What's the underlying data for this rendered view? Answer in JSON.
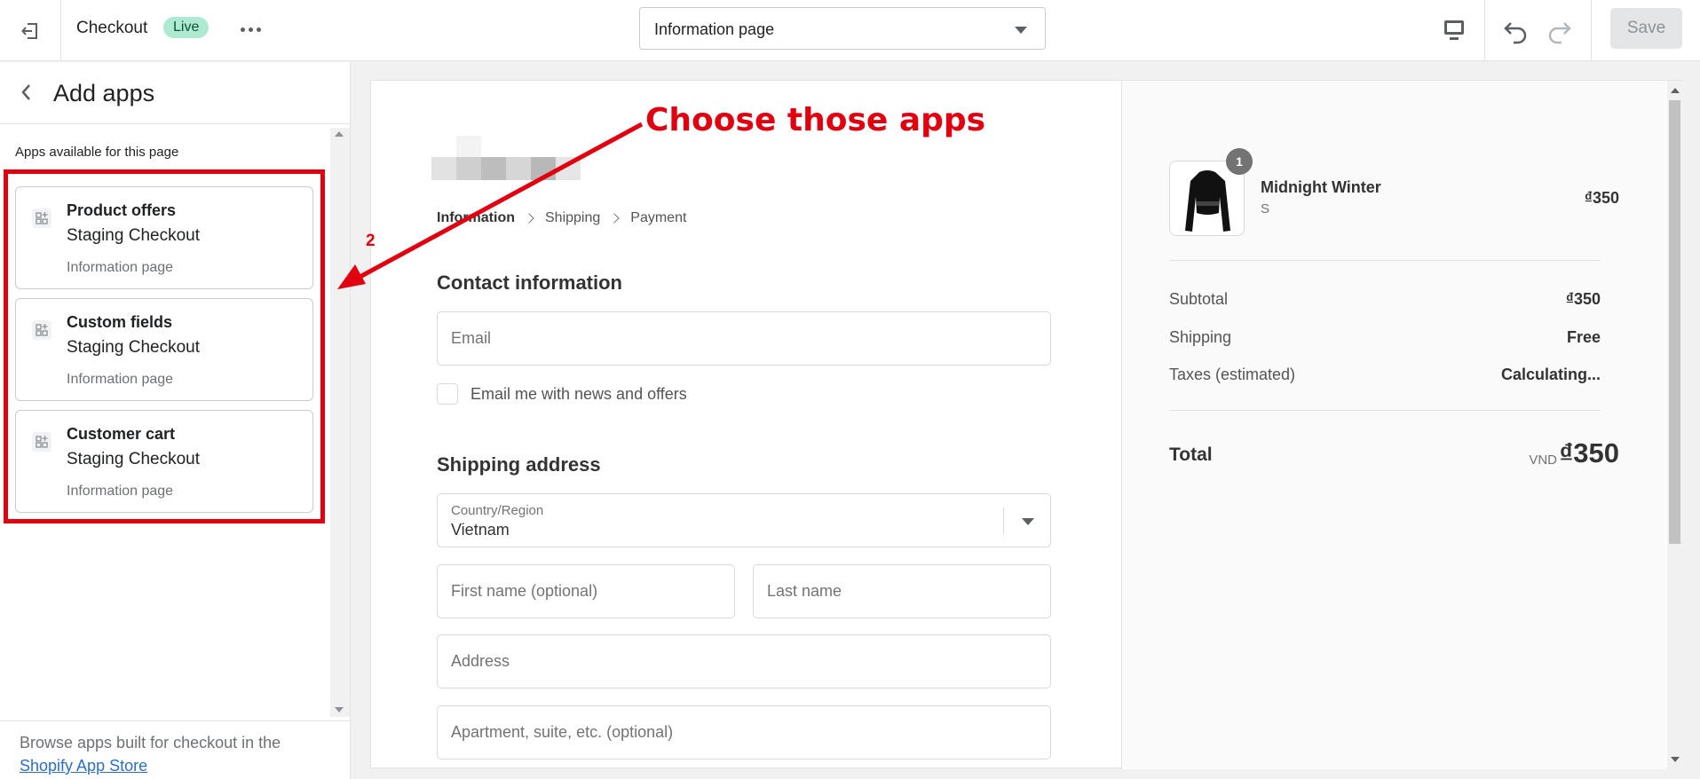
{
  "topbar": {
    "exit_icon": "exit-icon",
    "app_name": "Checkout",
    "status_badge": "Live",
    "more_icon": "more-horizontal-icon",
    "page_select_value": "Information page",
    "desktop_icon": "desktop-icon",
    "undo_icon": "undo-icon",
    "redo_icon": "redo-icon",
    "save_label": "Save"
  },
  "sidebar": {
    "back_icon": "chevron-left-icon",
    "title": "Add apps",
    "section_label": "Apps available for this page",
    "apps": [
      {
        "name": "Product offers",
        "source": "Staging Checkout",
        "page": "Information page",
        "icon": "app-block-icon"
      },
      {
        "name": "Custom fields",
        "source": "Staging Checkout",
        "page": "Information page",
        "icon": "app-block-icon"
      },
      {
        "name": "Customer cart",
        "source": "Staging Checkout",
        "page": "Information page",
        "icon": "app-block-icon"
      }
    ],
    "footer_text": "Browse apps built for checkout in the",
    "footer_link": "Shopify App Store"
  },
  "checkout": {
    "breadcrumbs": [
      "Information",
      "Shipping",
      "Payment"
    ],
    "contact_heading": "Contact information",
    "email_placeholder": "Email",
    "newsletter_label": "Email me with news and offers",
    "shipping_heading": "Shipping address",
    "country_label": "Country/Region",
    "country_value": "Vietnam",
    "first_name_placeholder": "First name (optional)",
    "last_name_placeholder": "Last name",
    "address_placeholder": "Address",
    "apartment_placeholder": "Apartment, suite, etc. (optional)"
  },
  "summary": {
    "product_name": "Midnight Winter",
    "product_variant": "S",
    "product_qty": "1",
    "product_price": "₫350",
    "subtotal_label": "Subtotal",
    "subtotal_value": "₫350",
    "shipping_label": "Shipping",
    "shipping_value": "Free",
    "taxes_label": "Taxes (estimated)",
    "taxes_value": "Calculating...",
    "total_label": "Total",
    "total_currency": "VND",
    "total_value": "₫350"
  },
  "annotation": {
    "title": "Choose those apps",
    "step_number": "2",
    "color": "#e00010"
  },
  "colors": {
    "live_badge_bg": "#aee9d1",
    "link": "#2c6ecb",
    "highlight": "#e00010"
  }
}
